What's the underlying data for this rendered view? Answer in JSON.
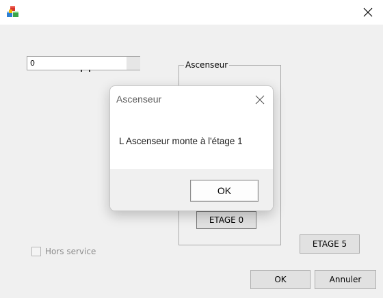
{
  "window": {
    "icon": "application-blocks-icon",
    "close_icon": "close-icon"
  },
  "form": {
    "counter_value": "0",
    "group_title": "Ascenseur",
    "etage0_label": "ETAGE 0",
    "etage5_label": "ETAGE 5",
    "ok_label": "OK",
    "cancel_label": "Annuler",
    "out_of_service_label": "Hors service",
    "out_of_service_checked": false
  },
  "dialog": {
    "title": "Ascenseur",
    "message": "L Ascenseur monte à l'étage 1",
    "ok_label": "OK",
    "close_icon": "close-icon"
  }
}
